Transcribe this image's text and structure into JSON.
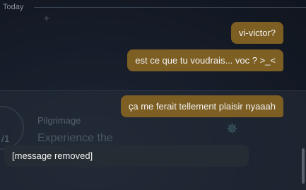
{
  "divider": {
    "label": "Today"
  },
  "background": {
    "counter_text": "/1",
    "card_subtitle": "Pilgrimage",
    "card_title": "Experience the"
  },
  "messages": [
    {
      "side": "outgoing",
      "text": "vi-victor?"
    },
    {
      "side": "outgoing",
      "text": "est ce que tu voudrais... voc ? >_<"
    },
    {
      "side": "outgoing",
      "text": "ça me ferait tellement plaisir nyaaah"
    },
    {
      "side": "incoming",
      "text": "[message removed]"
    }
  ],
  "colors": {
    "outgoing_bubble": "#7d5f24",
    "incoming_bubble": "#262c34",
    "background": "#1a2230"
  }
}
